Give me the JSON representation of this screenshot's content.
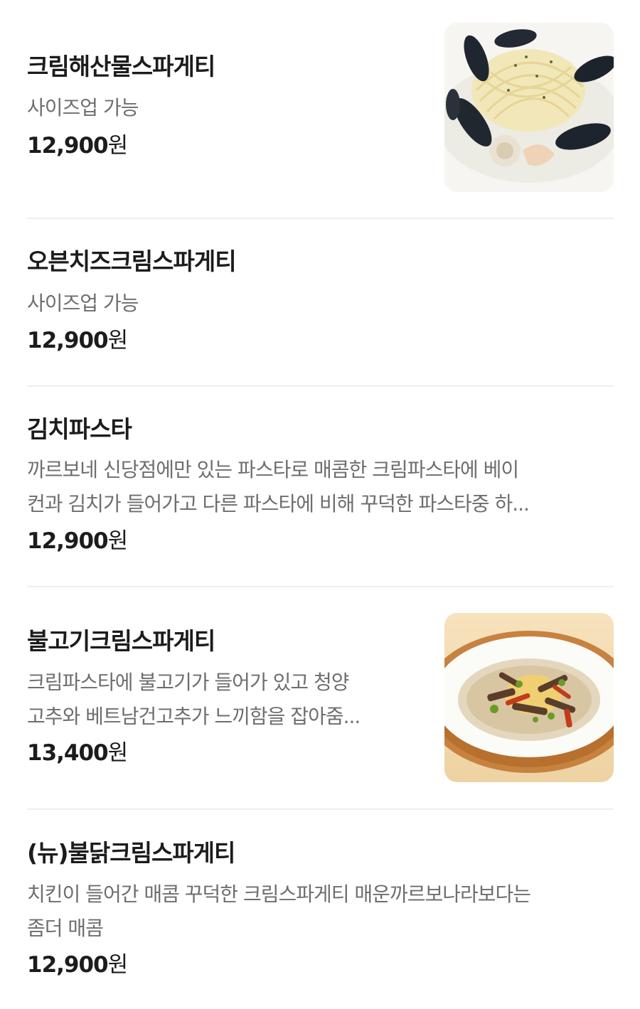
{
  "currency_suffix": "원",
  "items": [
    {
      "name": "크림해산물스파게티",
      "desc": [
        "사이즈업 가능"
      ],
      "price": "12,900",
      "photo": "seafood-cream-spaghetti"
    },
    {
      "name": "오븐치즈크림스파게티",
      "desc": [
        "사이즈업 가능"
      ],
      "price": "12,900"
    },
    {
      "name": "김치파스타",
      "desc": [
        "까르보네 신당점에만 있는 파스타로 매콤한 크림파스타에 베이",
        "컨과 김치가 들어가고 다른 파스타에 비해 꾸덕한 파스타중 하..."
      ],
      "price": "12,900"
    },
    {
      "name": "불고기크림스파게티",
      "desc": [
        "크림파스타에 불고기가 들어가 있고 청양",
        "고추와 베트남건고추가 느끼함을 잡아줌..."
      ],
      "price": "13,400",
      "photo": "bulgogi-cream-spaghetti"
    },
    {
      "name": "(뉴)불닭크림스파게티",
      "desc": [
        "치킨이 들어간 매콤 꾸덕한 크림스파게티 매운까르보나라보다는",
        "좀더 매콤"
      ],
      "price": "12,900"
    }
  ]
}
